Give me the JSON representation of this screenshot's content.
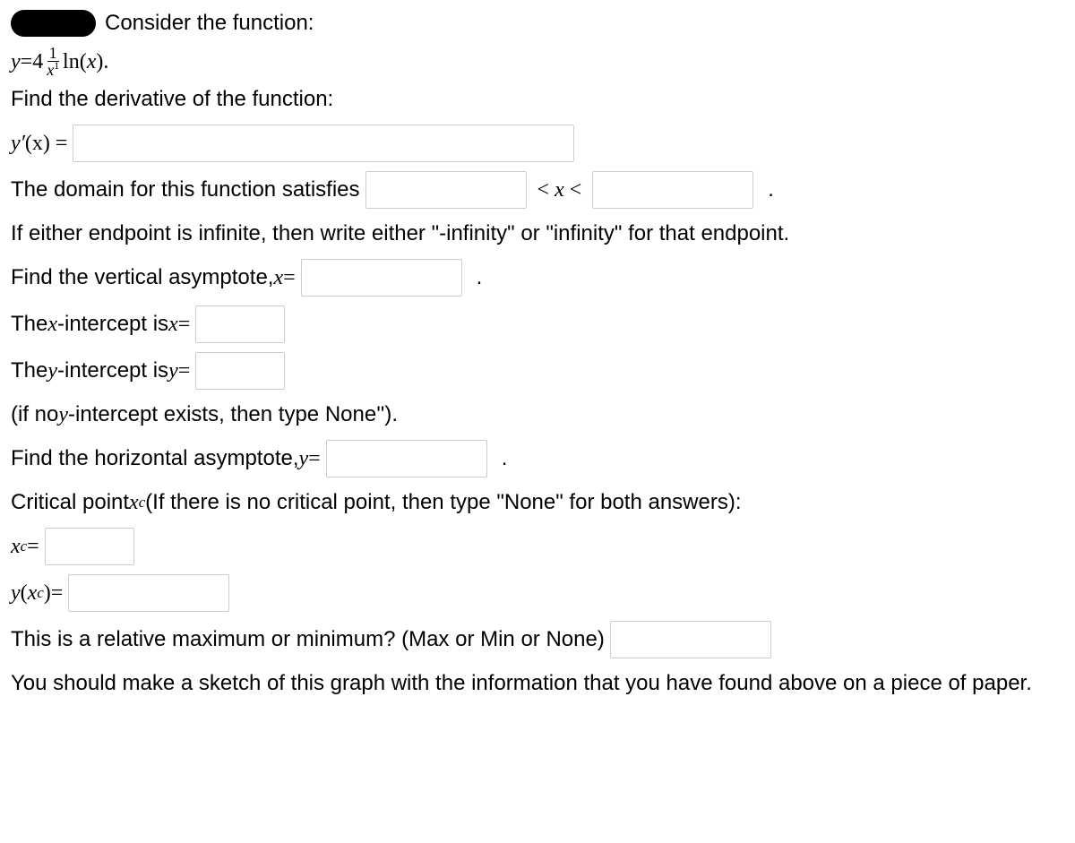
{
  "lines": {
    "consider": "Consider the function:",
    "eq_y": "y",
    "eq_eq": " = ",
    "eq_4": "4",
    "frac_num": "1",
    "frac_den_x": "x",
    "frac_den_exp": "1",
    "eq_ln": "ln(",
    "eq_lnx": "x",
    "eq_close": ").",
    "find_deriv": "Find the derivative of the function:",
    "yprime": "y′",
    "yprime_xarg": "(x) = ",
    "domain_text": "The domain for this function satisfies",
    "lt": "<",
    "x_letter": "x",
    "period": ".",
    "endpoint_note": "If either endpoint is infinite, then write either \"-infinity\" or \"infinity\" for that endpoint.",
    "vert_asym_a": "Find the vertical asymptote, ",
    "vert_asym_b": "x",
    "vert_asym_c": " = ",
    "xint_a": "The ",
    "xint_b": "x",
    "xint_c": "-intercept is ",
    "xint_d": "x",
    "xint_e": " = ",
    "yint_a": "The ",
    "yint_b": "y",
    "yint_c": "-intercept is ",
    "yint_d": "y",
    "yint_e": " = ",
    "yint_note_a": "(if no ",
    "yint_note_b": "y",
    "yint_note_c": "-intercept exists, then type None'').",
    "horiz_a": "Find the horizontal asymptote, ",
    "horiz_b": "y",
    "horiz_c": " = ",
    "crit_a": "Critical point ",
    "crit_b": "x",
    "crit_sub": "c",
    "crit_c": " (If there is no critical point, then type \"None\" for both answers):",
    "xc_a": "x",
    "xc_sub": "c",
    "xc_eq": " = ",
    "yxc_a": "y",
    "yxc_open": "(",
    "yxc_x": "x",
    "yxc_sub": "c",
    "yxc_close": ")",
    "yxc_eq": " = ",
    "maxmin": "This is a relative maximum or minimum? (Max or Min or None)",
    "sketch": "You should make a sketch of this graph with the information that you have found above on a piece of paper."
  }
}
